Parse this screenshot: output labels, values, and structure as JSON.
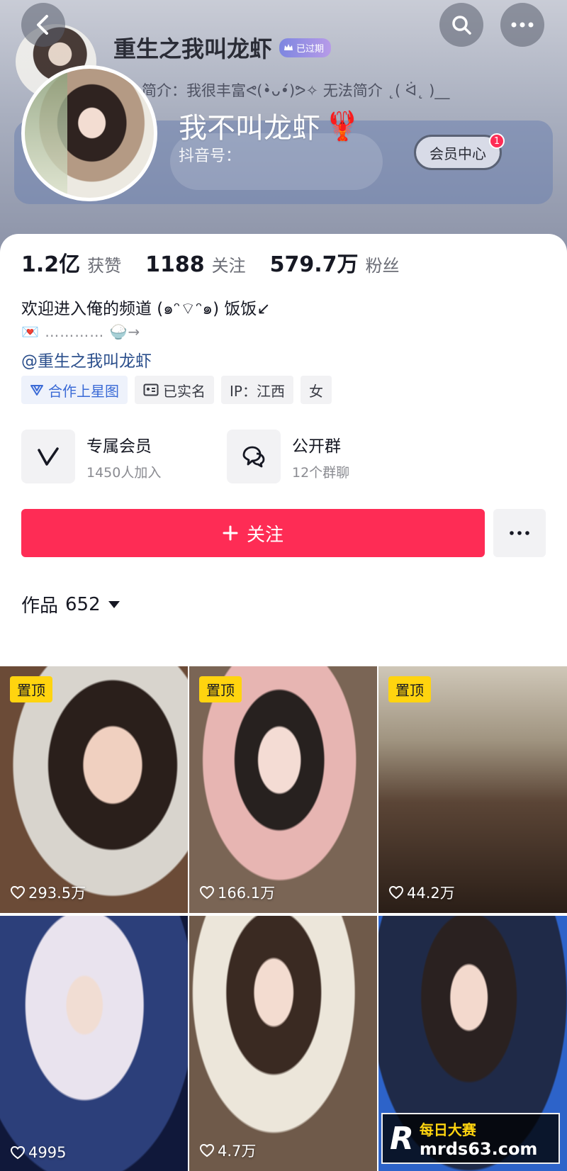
{
  "header": {
    "ghost_name": "重生之我叫龙虾",
    "expired_badge": "已过期",
    "ghost_bio": "简介：我很丰富ᕙ(•̀ᴗ•́)ᕗ✧ 无法简介 ˛( ᐛ˛ )__",
    "nickname": "我不叫龙虾",
    "nickname_emoji": "🦞",
    "douyin_id": "抖音号：",
    "member_center": "会员中心",
    "notify_count": "1"
  },
  "stats": [
    {
      "value": "1.2亿",
      "label": "获赞"
    },
    {
      "value": "1188",
      "label": "关注"
    },
    {
      "value": "579.7万",
      "label": "粉丝"
    }
  ],
  "bio": {
    "line1": "欢迎进入俺的频道 (๑ᵔ⌔ᵔ๑) 饭饭↙",
    "line2": "💌 ………… 🍚→",
    "line3": "@重生之我叫龙虾"
  },
  "tags": [
    {
      "label": "合作上星图",
      "icon": "star-map-icon"
    },
    {
      "label": "已实名",
      "icon": "id-card-icon"
    },
    {
      "label": "IP：江西"
    },
    {
      "label": "女"
    }
  ],
  "features": [
    {
      "title": "专属会员",
      "subtitle": "1450人加入",
      "icon": "v-member-icon"
    },
    {
      "title": "公开群",
      "subtitle": "12个群聊",
      "icon": "chat-group-icon"
    }
  ],
  "follow_button": "关注",
  "works": {
    "label": "作品",
    "count": "652"
  },
  "videos": [
    {
      "pinned": "置顶",
      "likes": "293.5万"
    },
    {
      "pinned": "置顶",
      "likes": "166.1万"
    },
    {
      "pinned": "置顶",
      "likes": "44.2万"
    },
    {
      "likes": "4995"
    },
    {
      "likes": "4.7万"
    },
    {
      "likes": ""
    }
  ],
  "watermark": {
    "mark": "R",
    "top": "每日大赛",
    "bottom": "mrds63.com"
  },
  "colors": {
    "accent": "#fe2c55",
    "pin": "#ffd40f",
    "link": "#2b4f8c"
  }
}
